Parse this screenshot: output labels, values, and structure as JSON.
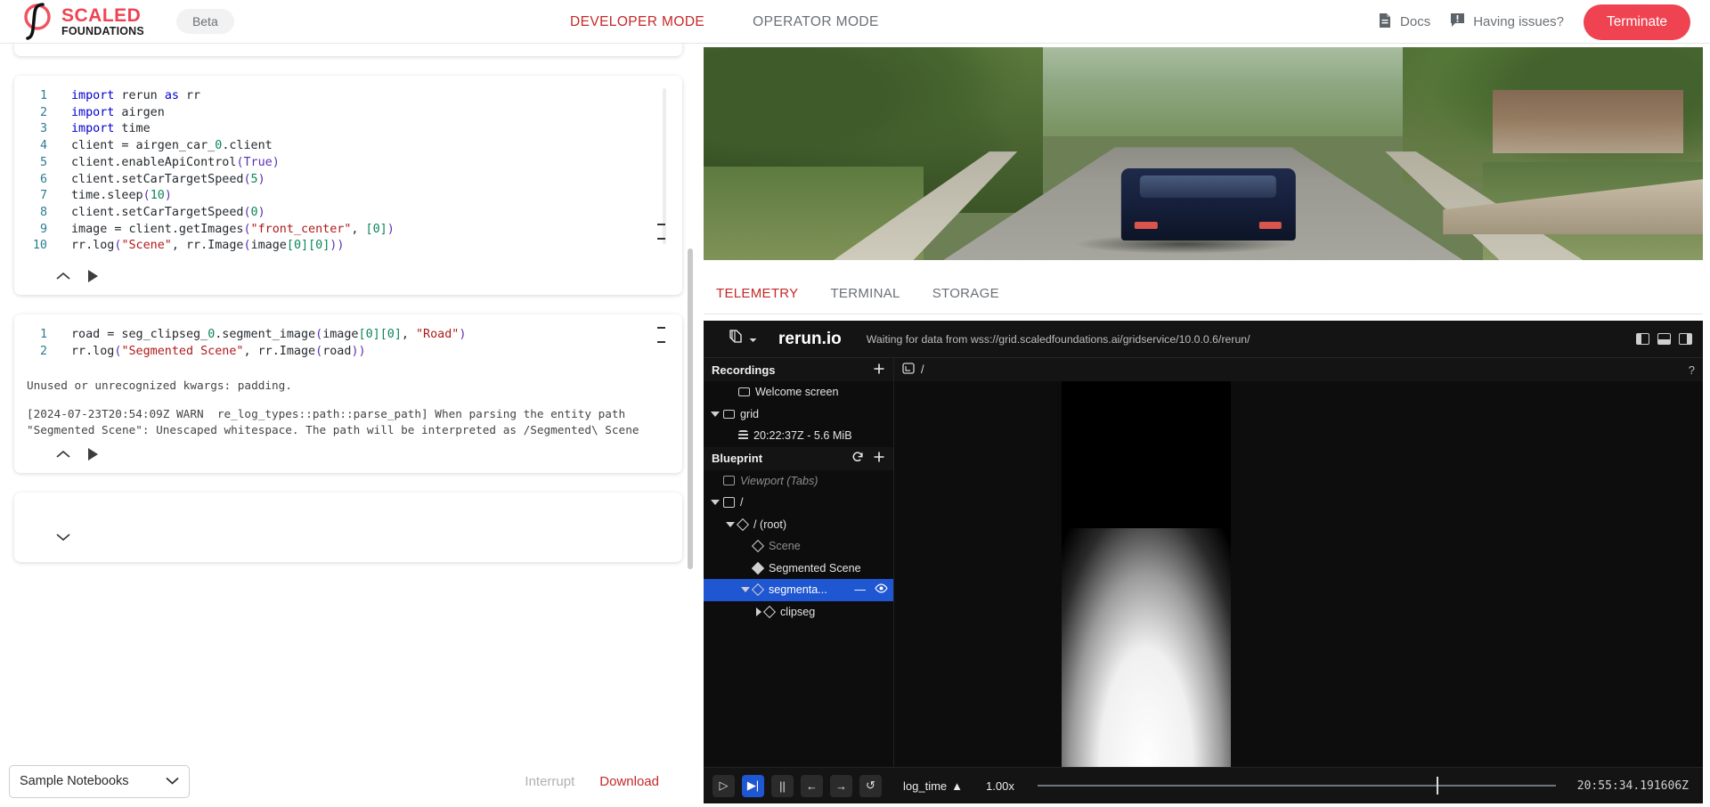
{
  "header": {
    "logo_top": "SCALED",
    "logo_bottom": "FOUNDATIONS",
    "beta_badge": "Beta",
    "modes": [
      {
        "label": "DEVELOPER MODE",
        "active": true
      },
      {
        "label": "OPERATOR MODE",
        "active": false
      }
    ],
    "docs_label": "Docs",
    "issues_label": "Having issues?",
    "terminate_label": "Terminate",
    "accent_red": "#ef4352",
    "active_tab_color": "#c62828"
  },
  "notebook": {
    "cell1": {
      "lines": [
        {
          "n": "1",
          "code": "import rerun as rr"
        },
        {
          "n": "2",
          "code": "import airgen"
        },
        {
          "n": "3",
          "code": "import time"
        },
        {
          "n": "4",
          "code": "client = airgen_car_0.client"
        },
        {
          "n": "5",
          "code": "client.enableApiControl(True)"
        },
        {
          "n": "6",
          "code": "client.setCarTargetSpeed(5)"
        },
        {
          "n": "7",
          "code": "time.sleep(10)"
        },
        {
          "n": "8",
          "code": "client.setCarTargetSpeed(0)"
        },
        {
          "n": "9",
          "code": "image = client.getImages(\"front_center\", [0])"
        },
        {
          "n": "10",
          "code": "rr.log(\"Scene\", rr.Image(image[0][0]))"
        }
      ]
    },
    "cell2": {
      "lines": [
        {
          "n": "1",
          "code": "road = seg_clipseg_0.segment_image(image[0][0], \"Road\")"
        },
        {
          "n": "2",
          "code": "rr.log(\"Segmented Scene\", rr.Image(road))"
        }
      ],
      "output_1": "Unused or unrecognized kwargs: padding.",
      "output_2": "[2024-07-23T20:54:09Z WARN  re_log_types::path::parse_path] When parsing the entity path\n\"Segmented Scene\": Unescaped whitespace. The path will be interpreted as /Segmented\\ Scene"
    },
    "bottom": {
      "sample_notebooks": "Sample Notebooks",
      "interrupt": "Interrupt",
      "download": "Download"
    }
  },
  "viewer_tabs": [
    {
      "label": "TELEMETRY",
      "active": true
    },
    {
      "label": "TERMINAL",
      "active": false
    },
    {
      "label": "STORAGE",
      "active": false
    }
  ],
  "rerun": {
    "title": "rerun.io",
    "status": "Waiting for data from wss://grid.scaledfoundations.ai/gridservice/10.0.0.6/rerun/",
    "recordings": {
      "header": "Recordings",
      "items": [
        {
          "label": "Welcome screen",
          "icon": "screen-icon",
          "indent": 1,
          "caret": "none",
          "dim": false
        },
        {
          "label": "grid",
          "icon": "screen-icon",
          "indent": 0,
          "caret": "down",
          "dim": false
        },
        {
          "label": "20:22:37Z - 5.6 MiB",
          "icon": "database-icon",
          "indent": 1,
          "caret": "none",
          "dim": false
        }
      ]
    },
    "blueprint": {
      "header": "Blueprint",
      "items": [
        {
          "label": "Viewport (Tabs)",
          "icon": "tab-icon",
          "indent": 0,
          "caret": "none",
          "italic": true
        },
        {
          "label": "/",
          "icon": "view-icon",
          "indent": 0,
          "caret": "down",
          "italic": false
        },
        {
          "label": "/ (root)",
          "icon": "diamond-icon",
          "indent": 1,
          "caret": "down",
          "italic": false
        },
        {
          "label": "Scene",
          "icon": "diamond-icon",
          "indent": 2,
          "caret": "none",
          "italic": false,
          "dim": true
        },
        {
          "label": "Segmented Scene",
          "icon": "diamond-filled-icon",
          "indent": 2,
          "caret": "none",
          "italic": false
        },
        {
          "label": "segmenta...",
          "icon": "diamond-icon",
          "indent": 2,
          "caret": "down",
          "selected": true
        },
        {
          "label": "clipseg",
          "icon": "diamond-icon",
          "indent": 3,
          "caret": "right",
          "italic": false
        }
      ]
    },
    "breadcrumb": "/",
    "help_glyph": "?",
    "timeline": {
      "play_glyph": "▷",
      "step_glyph": "▶|",
      "pause_glyph": "||",
      "back_glyph": "←",
      "forward_glyph": "→",
      "loop_glyph": "↺",
      "timeline_name": "log_time",
      "sort_glyph": "▲",
      "rate": "1.00x",
      "current_time": "20:55:34.191606Z"
    },
    "selected_row_color": "#1f56d1"
  }
}
